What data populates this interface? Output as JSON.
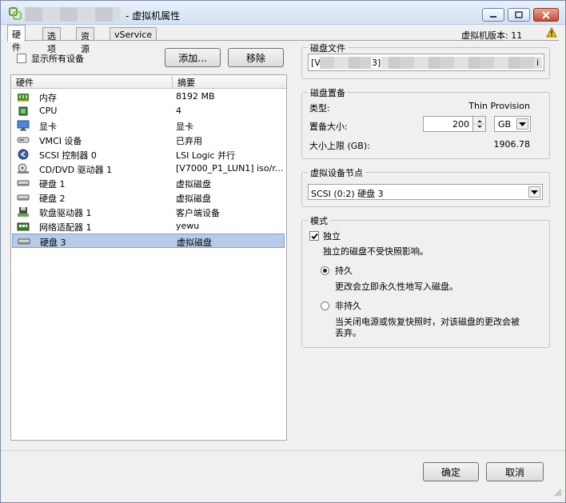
{
  "window": {
    "title": "- 虚拟机属性",
    "buttons": {
      "minimize": "minimize",
      "maximize": "maximize",
      "close": "close"
    }
  },
  "tabs": [
    {
      "label": "硬件"
    },
    {
      "label": "选项"
    },
    {
      "label": "资源"
    },
    {
      "label": "vService"
    }
  ],
  "vm_version": "虚拟机版本: 11",
  "toolbar": {
    "show_all_label": "显示所有设备",
    "add_label": "添加...",
    "remove_label": "移除"
  },
  "hardware_table": {
    "columns": [
      "硬件",
      "摘要"
    ],
    "rows": [
      {
        "name": "内存",
        "summary": "8192 MB",
        "icon": "memory-icon"
      },
      {
        "name": "CPU",
        "summary": "4",
        "icon": "cpu-icon"
      },
      {
        "name": "显卡",
        "summary": "显卡",
        "icon": "monitor-icon"
      },
      {
        "name": "VMCI 设备",
        "summary": "已弃用",
        "icon": "vmci-icon"
      },
      {
        "name": "SCSI 控制器 0",
        "summary": "LSI Logic 并行",
        "icon": "scsi-controller-icon"
      },
      {
        "name": "CD/DVD 驱动器 1",
        "summary": "[V7000_P1_LUN1] iso/r...",
        "icon": "cd-dvd-icon"
      },
      {
        "name": "硬盘 1",
        "summary": "虚拟磁盘",
        "icon": "hard-disk-icon"
      },
      {
        "name": "硬盘 2",
        "summary": "虚拟磁盘",
        "icon": "hard-disk-icon"
      },
      {
        "name": "软盘驱动器 1",
        "summary": "客户端设备",
        "icon": "floppy-icon"
      },
      {
        "name": "网络适配器 1",
        "summary": "yewu",
        "icon": "network-adapter-icon"
      },
      {
        "name": "硬盘 3",
        "summary": "虚拟磁盘",
        "icon": "hard-disk-icon"
      }
    ]
  },
  "disk_file": {
    "title": "磁盘文件",
    "value_start": "[V",
    "value_mid": "3]",
    "value_end": "i"
  },
  "provisioning": {
    "title": "磁盘置备",
    "type_label": "类型:",
    "type_value": "Thin Provision",
    "size_label": "置备大小:",
    "size_value": "200",
    "unit_value": "GB",
    "max_label": "大小上限 (GB):",
    "max_value": "1906.78"
  },
  "device_node": {
    "title": "虚拟设备节点",
    "selected": "SCSI (0:2) 硬盘 3"
  },
  "mode": {
    "title": "模式",
    "independent_label": "独立",
    "independent_checked": true,
    "independent_desc": "独立的磁盘不受快照影响。",
    "persistent_label": "持久",
    "persistent_selected": true,
    "persistent_desc": "更改会立即永久性地写入磁盘。",
    "nonpersistent_label": "非持久",
    "nonpersistent_desc_1": "当关闭电源或恢复快照时，对该磁盘的更改会被",
    "nonpersistent_desc_2": "丢弃。"
  },
  "footer": {
    "ok_label": "确定",
    "cancel_label": "取消"
  },
  "colors": {
    "selection": "#b5cbe8",
    "close_button": "#c6492f",
    "warning": "#f2c200"
  }
}
